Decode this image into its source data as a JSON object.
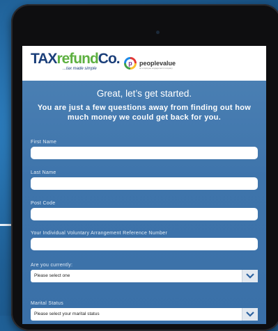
{
  "brand": {
    "logo_part1": "TAX",
    "logo_part2": "refund",
    "logo_part3": "Co.",
    "tagline": "...tax made simple",
    "partner_name": "peoplevalue",
    "partner_tagline": "an employee engagement company",
    "partner_mark": "p"
  },
  "form": {
    "heading": "Great, let’s get started.",
    "subheading": "You are just a few questions away from finding out how much money we could get back for you.",
    "fields": [
      {
        "label": "First Name",
        "value": ""
      },
      {
        "label": "Last Name",
        "value": ""
      },
      {
        "label": "Post Code",
        "value": ""
      },
      {
        "label": "Your Individual Voluntary Arrangement Reference Number",
        "value": ""
      }
    ],
    "selects": [
      {
        "label": "Are you currently:",
        "selected": "Please select one"
      },
      {
        "label": "Marital Status",
        "selected": "Please select your marital status"
      }
    ]
  },
  "colors": {
    "background": "#1f5f95",
    "form_blue": "#3e74ab",
    "brand_navy": "#1b3f7a",
    "brand_green": "#5db040"
  }
}
